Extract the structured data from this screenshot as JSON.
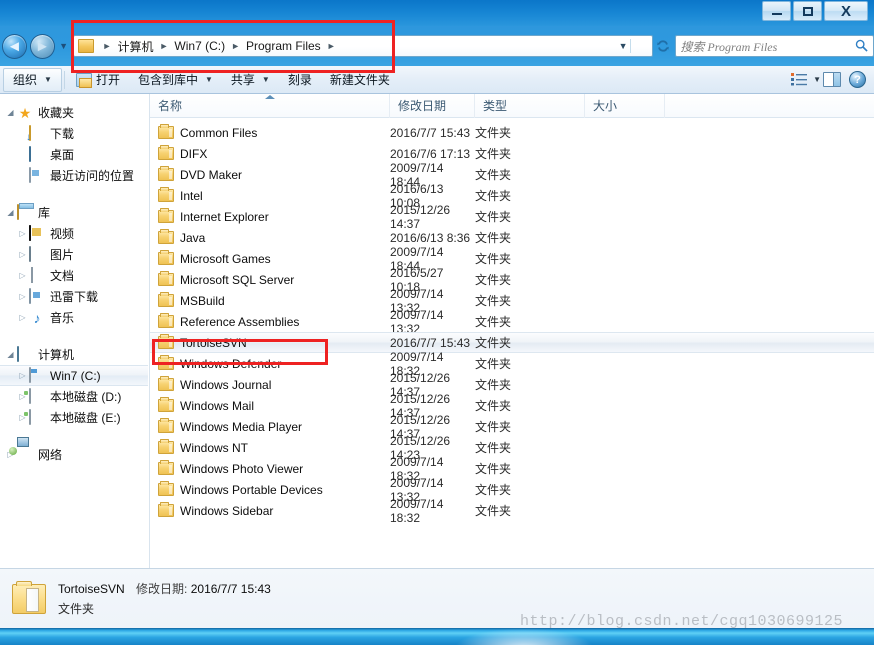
{
  "window": {
    "controls": {
      "minimize": "–",
      "maximize": "▫",
      "close": "X"
    }
  },
  "address_bar": {
    "back_icon": "◄",
    "forward_icon": "►",
    "history_caret": "▼",
    "dropdown_caret": "▼",
    "refresh_icon": "↻",
    "crumbs": [
      "计算机",
      "Win7 (C:)",
      "Program Files"
    ],
    "separator": "►"
  },
  "search": {
    "placeholder": "搜索 Program Files"
  },
  "toolbar": {
    "organize": "组织",
    "open": "打开",
    "include_in_library": "包含到库中",
    "share": "共享",
    "burn": "刻录",
    "new_folder": "新建文件夹",
    "caret": "▼",
    "help": "?"
  },
  "sidebar": {
    "groups": [
      {
        "name": "favorites",
        "label": "收藏夹",
        "icon": "star-icon",
        "expanded": true,
        "items": [
          {
            "label": "下载",
            "icon": "downloads-icon"
          },
          {
            "label": "桌面",
            "icon": "desktop-icon"
          },
          {
            "label": "最近访问的位置",
            "icon": "recent-places-icon"
          }
        ]
      },
      {
        "name": "libraries",
        "label": "库",
        "icon": "library-icon",
        "expanded": true,
        "items": [
          {
            "label": "视频",
            "icon": "video-icon"
          },
          {
            "label": "图片",
            "icon": "pictures-icon"
          },
          {
            "label": "文档",
            "icon": "documents-icon"
          },
          {
            "label": "迅雷下载",
            "icon": "thunder-download-icon"
          },
          {
            "label": "音乐",
            "icon": "music-icon"
          }
        ]
      },
      {
        "name": "computer",
        "label": "计算机",
        "icon": "computer-icon",
        "expanded": true,
        "items": [
          {
            "label": "Win7 (C:)",
            "icon": "system-drive-icon",
            "selected": true
          },
          {
            "label": "本地磁盘 (D:)",
            "icon": "drive-icon"
          },
          {
            "label": "本地磁盘 (E:)",
            "icon": "drive-icon"
          }
        ]
      },
      {
        "name": "network",
        "label": "网络",
        "icon": "network-icon",
        "expanded": false,
        "items": []
      }
    ]
  },
  "file_list": {
    "columns": [
      "名称",
      "修改日期",
      "类型",
      "大小"
    ],
    "sorted_column": "名称",
    "sort_direction": "ascending",
    "rows": [
      {
        "name": "Common Files",
        "date": "2016/7/7 15:43",
        "type": "文件夹",
        "size": ""
      },
      {
        "name": "DIFX",
        "date": "2016/7/6 17:13",
        "type": "文件夹",
        "size": ""
      },
      {
        "name": "DVD Maker",
        "date": "2009/7/14 18:44",
        "type": "文件夹",
        "size": ""
      },
      {
        "name": "Intel",
        "date": "2016/6/13 10:08",
        "type": "文件夹",
        "size": ""
      },
      {
        "name": "Internet Explorer",
        "date": "2015/12/26 14:37",
        "type": "文件夹",
        "size": ""
      },
      {
        "name": "Java",
        "date": "2016/6/13 8:36",
        "type": "文件夹",
        "size": ""
      },
      {
        "name": "Microsoft Games",
        "date": "2009/7/14 18:44",
        "type": "文件夹",
        "size": ""
      },
      {
        "name": "Microsoft SQL Server",
        "date": "2016/5/27 10:18",
        "type": "文件夹",
        "size": ""
      },
      {
        "name": "MSBuild",
        "date": "2009/7/14 13:32",
        "type": "文件夹",
        "size": ""
      },
      {
        "name": "Reference Assemblies",
        "date": "2009/7/14 13:32",
        "type": "文件夹",
        "size": ""
      },
      {
        "name": "TortoiseSVN",
        "date": "2016/7/7 15:43",
        "type": "文件夹",
        "size": "",
        "selected": true
      },
      {
        "name": "Windows Defender",
        "date": "2009/7/14 18:32",
        "type": "文件夹",
        "size": ""
      },
      {
        "name": "Windows Journal",
        "date": "2015/12/26 14:37",
        "type": "文件夹",
        "size": ""
      },
      {
        "name": "Windows Mail",
        "date": "2015/12/26 14:37",
        "type": "文件夹",
        "size": ""
      },
      {
        "name": "Windows Media Player",
        "date": "2015/12/26 14:37",
        "type": "文件夹",
        "size": ""
      },
      {
        "name": "Windows NT",
        "date": "2015/12/26 14:23",
        "type": "文件夹",
        "size": ""
      },
      {
        "name": "Windows Photo Viewer",
        "date": "2009/7/14 18:32",
        "type": "文件夹",
        "size": ""
      },
      {
        "name": "Windows Portable Devices",
        "date": "2009/7/14 13:32",
        "type": "文件夹",
        "size": ""
      },
      {
        "name": "Windows Sidebar",
        "date": "2009/7/14 18:32",
        "type": "文件夹",
        "size": ""
      }
    ]
  },
  "status_bar": {
    "name": "TortoiseSVN",
    "modified_label": "修改日期:",
    "modified_value": "2016/7/7 15:43",
    "type": "文件夹"
  },
  "watermark": {
    "text": "http://blog.csdn.net/cgq1030699125"
  },
  "annotations": {
    "accent_color": "#ee2222",
    "boxes": [
      "address-bar-highlight",
      "tortoisesvn-row-highlight"
    ]
  }
}
